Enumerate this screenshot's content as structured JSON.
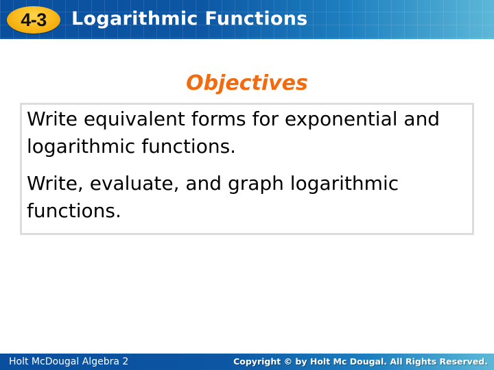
{
  "header": {
    "lesson_number": "4-3",
    "title": "Logarithmic Functions"
  },
  "main": {
    "heading": "Objectives",
    "objectives": [
      "Write equivalent forms for exponential and logarithmic functions.",
      "Write, evaluate, and graph logarithmic functions."
    ]
  },
  "footer": {
    "publisher_course": "Holt McDougal Algebra 2",
    "copyright": "Copyright © by Holt Mc Dougal. All Rights Reserved."
  },
  "colors": {
    "header_blue": "#0c56a3",
    "badge_yellow": "#f7b414",
    "heading_orange": "#f26b0f",
    "box_border": "#dcdcdc"
  }
}
